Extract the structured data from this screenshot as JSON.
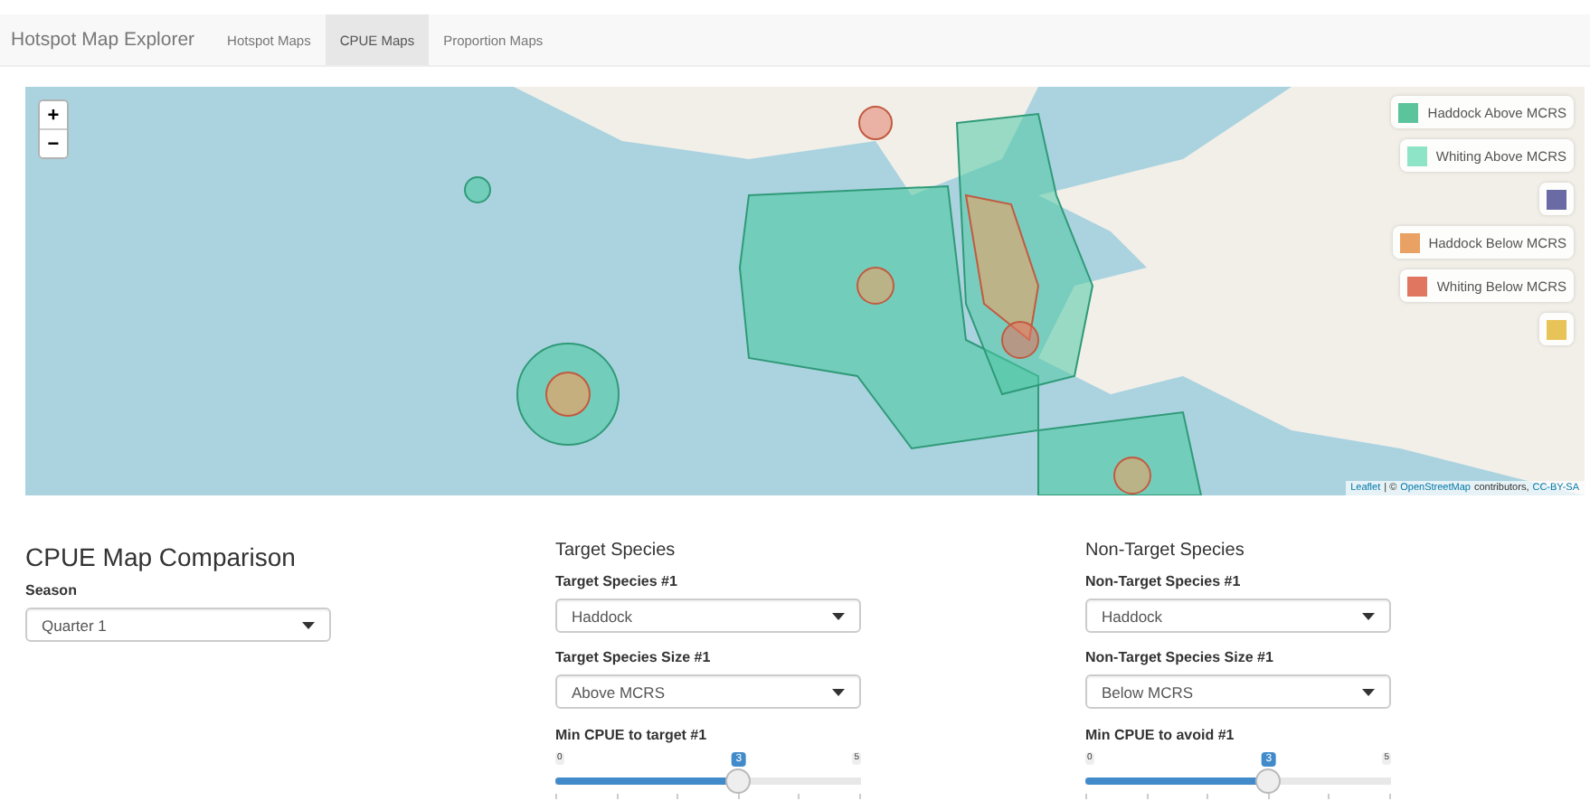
{
  "navbar": {
    "brand": "Hotspot Map Explorer",
    "tabs": [
      {
        "label": "Hotspot Maps",
        "selected": false
      },
      {
        "label": "CPUE Maps",
        "selected": true
      },
      {
        "label": "Proportion Maps",
        "selected": false
      }
    ]
  },
  "map": {
    "zoom_controls": [
      "+",
      "−"
    ],
    "legend": [
      {
        "label": "Haddock Above MCRS",
        "color": "#5cc49c"
      },
      {
        "label": "Whiting Above MCRS",
        "color": "#8ee4c6"
      },
      {
        "color": "#6a6aa4"
      },
      {
        "label": "Haddock Below MCRS",
        "color": "#e9a264"
      },
      {
        "label": "Whiting Below MCRS",
        "color": "#e07560"
      },
      {
        "color": "#e8c357"
      }
    ],
    "attribution": [
      {
        "kind": "link",
        "text": "Leaflet"
      },
      {
        "kind": "text",
        "text": "| ©"
      },
      {
        "kind": "link",
        "text": "OpenStreetMap"
      },
      {
        "kind": "text",
        "text": "contributors,"
      },
      {
        "kind": "link",
        "text": "CC-BY-SA"
      }
    ]
  },
  "comparison": {
    "title": "CPUE Map Comparison",
    "season": {
      "label": "Season",
      "value": "Quarter 1"
    }
  },
  "target": {
    "heading": "Target Species",
    "species": {
      "label": "Target Species #1",
      "value": "Haddock"
    },
    "size": {
      "label": "Target Species Size #1",
      "value": "Above MCRS"
    },
    "slider": {
      "label": "Min CPUE to target #1",
      "min": "0",
      "max": "5",
      "value": "3",
      "level": 0.6
    }
  },
  "non_target": {
    "heading": "Non-Target Species",
    "species": {
      "label": "Non-Target Species #1",
      "value": "Haddock"
    },
    "size": {
      "label": "Non-Target Species Size #1",
      "value": "Below MCRS"
    },
    "slider": {
      "label": "Min CPUE to avoid #1",
      "min": "0",
      "max": "5",
      "value": "3",
      "level": 0.6
    }
  }
}
